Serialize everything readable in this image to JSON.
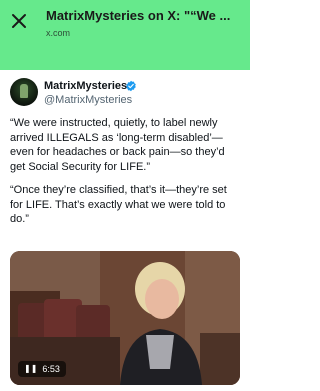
{
  "header": {
    "title": "MatrixMysteries on X: \"“We ...",
    "url": "x.com"
  },
  "author": {
    "display_name": "MatrixMysteries",
    "handle": "@MatrixMysteries"
  },
  "tweet": {
    "paragraphs": [
      "“We were instructed, quietly, to label newly arrived ILLEGALS as ‘long-term disabled’—even for headaches or back pain—so they’d get Social Security for LIFE.”",
      "“Once they’re classified, that’s it—they’re set for LIFE. That’s exactly what we were told to do.”"
    ]
  },
  "video": {
    "duration": "6:53",
    "play_state_icon": "pause-icon"
  },
  "colors": {
    "header_bg": "#66e98c",
    "verified_blue": "#1d9bf0",
    "text_primary": "#0f1419",
    "text_secondary": "#536471"
  }
}
